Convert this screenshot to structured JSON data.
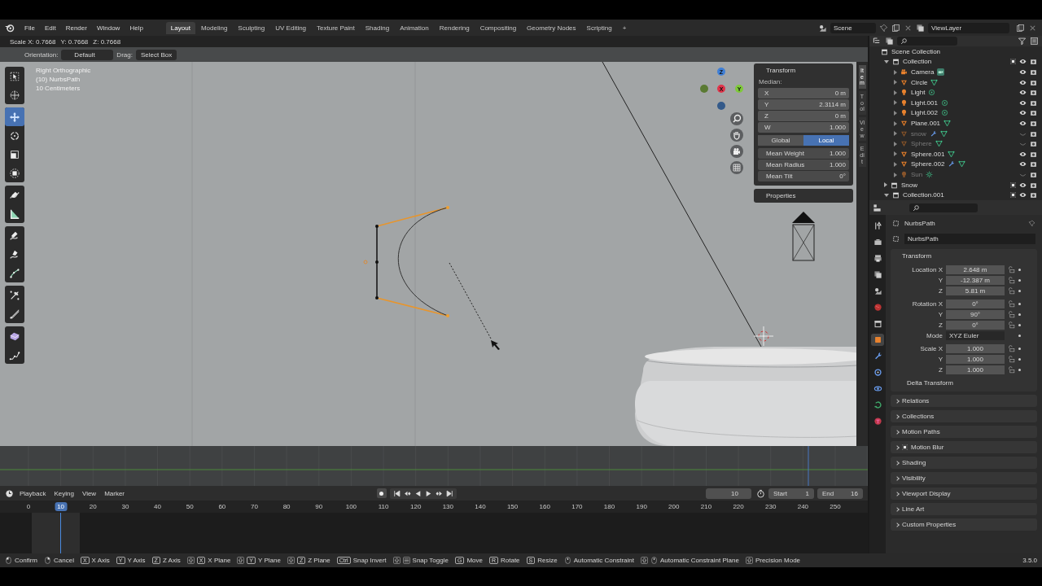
{
  "menu": [
    "File",
    "Edit",
    "Render",
    "Window",
    "Help"
  ],
  "workspaces": [
    {
      "label": "Layout",
      "selected": true
    },
    {
      "label": "Modeling",
      "selected": false
    },
    {
      "label": "Sculpting",
      "selected": false
    },
    {
      "label": "UV Editing",
      "selected": false
    },
    {
      "label": "Texture Paint",
      "selected": false
    },
    {
      "label": "Shading",
      "selected": false
    },
    {
      "label": "Animation",
      "selected": false
    },
    {
      "label": "Rendering",
      "selected": false
    },
    {
      "label": "Compositing",
      "selected": false
    },
    {
      "label": "Geometry Nodes",
      "selected": false
    },
    {
      "label": "Scripting",
      "selected": false
    }
  ],
  "add_tab": "+",
  "scene": "Scene",
  "view_layer": "ViewLayer",
  "operator_status": [
    "Scale X: 0.7668",
    "Y: 0.7668",
    "Z: 0.7668"
  ],
  "tool_header": {
    "orientation_label": "Orientation:",
    "orientation": "Default",
    "drag_label": "Drag:",
    "drag": "Select Box"
  },
  "viewport": {
    "overlay_text": [
      "Right Orthographic",
      "(10) NurbsPath",
      "10 Centimeters"
    ],
    "tool_groups": [
      [
        {
          "kind": "select-box",
          "selected": false
        },
        {
          "kind": "cursor",
          "selected": false
        }
      ],
      [
        {
          "kind": "move",
          "selected": true
        },
        {
          "kind": "rotate",
          "selected": false
        },
        {
          "kind": "scale",
          "selected": false
        },
        {
          "kind": "transform",
          "selected": false
        }
      ],
      [
        {
          "kind": "annotate",
          "selected": false
        },
        {
          "kind": "measure",
          "selected": false
        }
      ],
      [
        {
          "kind": "draw",
          "selected": false
        },
        {
          "kind": "pen",
          "selected": false
        },
        {
          "kind": "curve",
          "selected": false
        }
      ],
      [
        {
          "kind": "radius",
          "selected": false
        },
        {
          "kind": "tilt",
          "selected": false
        }
      ],
      [
        {
          "kind": "extrude",
          "selected": false
        },
        {
          "kind": "randomize",
          "selected": false
        }
      ]
    ],
    "gizmo": [
      "Z",
      "X",
      "Y"
    ]
  },
  "sidebar": {
    "panel_title": "Transform",
    "median_label": "Median:",
    "fields": [
      {
        "label": "X",
        "value": "0 m"
      },
      {
        "label": "Y",
        "value": "2.3114 m"
      },
      {
        "label": "Z",
        "value": "0 m"
      },
      {
        "label": "W",
        "value": "1.000"
      }
    ],
    "space": [
      {
        "label": "Global",
        "selected": false
      },
      {
        "label": "Local",
        "selected": true
      }
    ],
    "stats": [
      {
        "label": "Mean Weight",
        "value": "1.000"
      },
      {
        "label": "Mean Radius",
        "value": "1.000"
      },
      {
        "label": "Mean Tilt",
        "value": "0°"
      }
    ],
    "properties_title": "Properties",
    "tabs": [
      {
        "label": "Item",
        "selected": true
      },
      {
        "label": "Tool",
        "selected": false
      },
      {
        "label": "View",
        "selected": false
      },
      {
        "label": "Edit",
        "selected": false
      }
    ]
  },
  "timeline": {
    "menus": [
      "Playback",
      "Keying",
      "View",
      "Marker"
    ],
    "current_frame": "10",
    "start_label": "Start",
    "start": "1",
    "end_label": "End",
    "end": "16",
    "ruler": [
      {
        "label": "0",
        "selected": false
      },
      {
        "label": "10",
        "selected": true
      },
      {
        "label": "20",
        "selected": false
      },
      {
        "label": "30",
        "selected": false
      },
      {
        "label": "40",
        "selected": false
      },
      {
        "label": "50",
        "selected": false
      },
      {
        "label": "60",
        "selected": false
      },
      {
        "label": "70",
        "selected": false
      },
      {
        "label": "80",
        "selected": false
      },
      {
        "label": "90",
        "selected": false
      },
      {
        "label": "100",
        "selected": false
      },
      {
        "label": "110",
        "selected": false
      },
      {
        "label": "120",
        "selected": false
      },
      {
        "label": "130",
        "selected": false
      },
      {
        "label": "140",
        "selected": false
      },
      {
        "label": "150",
        "selected": false
      },
      {
        "label": "160",
        "selected": false
      },
      {
        "label": "170",
        "selected": false
      },
      {
        "label": "180",
        "selected": false
      },
      {
        "label": "190",
        "selected": false
      },
      {
        "label": "200",
        "selected": false
      },
      {
        "label": "210",
        "selected": false
      },
      {
        "label": "220",
        "selected": false
      },
      {
        "label": "230",
        "selected": false
      },
      {
        "label": "240",
        "selected": false
      },
      {
        "label": "250",
        "selected": false
      }
    ]
  },
  "outliner": {
    "root": {
      "name": "Scene Collection",
      "children": [
        {
          "name": "Collection",
          "checked": true,
          "expanded": true,
          "children": [
            {
              "name": "Camera",
              "kind": "camera",
              "data": {
                "kind": "camera"
              },
              "modifier": false,
              "hidden": false
            },
            {
              "name": "Circle",
              "kind": "mesh",
              "data": {
                "kind": "mesh"
              },
              "modifier": false,
              "hidden": false
            },
            {
              "name": "Light",
              "kind": "light",
              "data": {
                "kind": "light"
              },
              "modifier": false,
              "hidden": false
            },
            {
              "name": "Light.001",
              "kind": "light",
              "data": {
                "kind": "light"
              },
              "modifier": false,
              "hidden": false
            },
            {
              "name": "Light.002",
              "kind": "light",
              "data": {
                "kind": "light"
              },
              "modifier": false,
              "hidden": false
            },
            {
              "name": "Plane.001",
              "kind": "mesh",
              "data": {
                "kind": "mesh"
              },
              "modifier": false,
              "hidden": false
            },
            {
              "name": "snow",
              "kind": "mesh",
              "data": {
                "kind": "mesh"
              },
              "modifier": true,
              "hidden": true
            },
            {
              "name": "Sphere",
              "kind": "mesh",
              "data": {
                "kind": "mesh"
              },
              "modifier": false,
              "hidden": true
            },
            {
              "name": "Sphere.001",
              "kind": "mesh",
              "data": {
                "kind": "mesh"
              },
              "modifier": false,
              "hidden": false
            },
            {
              "name": "Sphere.002",
              "kind": "mesh",
              "data": {
                "kind": "mesh"
              },
              "modifier": true,
              "hidden": false
            },
            {
              "name": "Sun",
              "kind": "light",
              "data": {
                "kind": "sun"
              },
              "modifier": false,
              "hidden": true
            }
          ]
        },
        {
          "name": "Snow",
          "checked": true,
          "expanded": false
        },
        {
          "name": "Collection.001",
          "checked": true,
          "expanded": true
        }
      ]
    }
  },
  "properties": {
    "tabs": [
      {
        "kind": "tool",
        "selected": false
      },
      {
        "kind": "render",
        "selected": false
      },
      {
        "kind": "output",
        "selected": false
      },
      {
        "kind": "view-layer",
        "selected": false
      },
      {
        "kind": "scene",
        "selected": false
      },
      {
        "kind": "world",
        "selected": false
      },
      {
        "kind": "collection",
        "selected": false
      },
      {
        "kind": "object",
        "selected": true
      },
      {
        "kind": "modifier",
        "selected": false
      },
      {
        "kind": "particles",
        "selected": false
      },
      {
        "kind": "physics",
        "selected": false
      },
      {
        "kind": "constraint",
        "selected": false
      },
      {
        "kind": "data",
        "selected": false
      }
    ],
    "object_name": "NurbsPath",
    "datablock": "NurbsPath",
    "section": "Transform",
    "groups": [
      [
        {
          "label": "Location X",
          "value": "2.648 m",
          "kind": "field"
        },
        {
          "label": "Y",
          "value": "-12.387 m",
          "kind": "field"
        },
        {
          "label": "Z",
          "value": "5.81 m",
          "kind": "field"
        }
      ],
      [
        {
          "label": "Rotation X",
          "value": "0°",
          "kind": "field"
        },
        {
          "label": "Y",
          "value": "90°",
          "kind": "field"
        },
        {
          "label": "Z",
          "value": "0°",
          "kind": "field"
        },
        {
          "label": "Mode",
          "value": "XYZ Euler",
          "kind": "dropdown"
        }
      ],
      [
        {
          "label": "Scale X",
          "value": "1.000",
          "kind": "field"
        },
        {
          "label": "Y",
          "value": "1.000",
          "kind": "field"
        },
        {
          "label": "Z",
          "value": "1.000",
          "kind": "field"
        }
      ]
    ],
    "subsection": "Delta Transform",
    "panels": [
      {
        "label": "Relations",
        "kind": "panel"
      },
      {
        "label": "Collections",
        "kind": "panel"
      },
      {
        "label": "Motion Paths",
        "kind": "panel"
      },
      {
        "label": "Motion Blur",
        "kind": "toggle",
        "checked": true
      },
      {
        "label": "Shading",
        "kind": "panel"
      },
      {
        "label": "Visibility",
        "kind": "panel"
      },
      {
        "label": "Viewport Display",
        "kind": "panel"
      },
      {
        "label": "Line Art",
        "kind": "panel"
      },
      {
        "label": "Custom Properties",
        "kind": "panel"
      }
    ]
  },
  "status_bar": {
    "items": [
      {
        "kind": "mouse-left",
        "label": "Confirm"
      },
      {
        "kind": "mouse-right",
        "label": "Cancel"
      },
      {
        "kind": "key",
        "keys": [
          "X"
        ],
        "label": "X Axis"
      },
      {
        "kind": "key",
        "keys": [
          "Y"
        ],
        "label": "Y Axis"
      },
      {
        "kind": "key",
        "keys": [
          "Z"
        ],
        "label": "Z Axis"
      },
      {
        "kind": "shift",
        "keys": [
          "X"
        ],
        "label": "X Plane"
      },
      {
        "kind": "shift",
        "keys": [
          "Y"
        ],
        "label": "Y Plane"
      },
      {
        "kind": "shift",
        "keys": [
          "Z"
        ],
        "label": "Z Plane"
      },
      {
        "kind": "key",
        "keys": [
          "Ctrl"
        ],
        "label": "Snap Invert"
      },
      {
        "kind": "shift-tab",
        "label": "Snap Toggle"
      },
      {
        "kind": "key",
        "keys": [
          "G"
        ],
        "label": "Move"
      },
      {
        "kind": "key",
        "keys": [
          "R"
        ],
        "label": "Rotate"
      },
      {
        "kind": "key",
        "keys": [
          "S"
        ],
        "label": "Resize"
      },
      {
        "kind": "mouse-middle",
        "label": "Automatic Constraint"
      },
      {
        "kind": "shift-mouse-middle",
        "label": "Automatic Constraint Plane"
      },
      {
        "kind": "shift",
        "label": "Precision Mode"
      }
    ],
    "version": "3.5.0"
  }
}
